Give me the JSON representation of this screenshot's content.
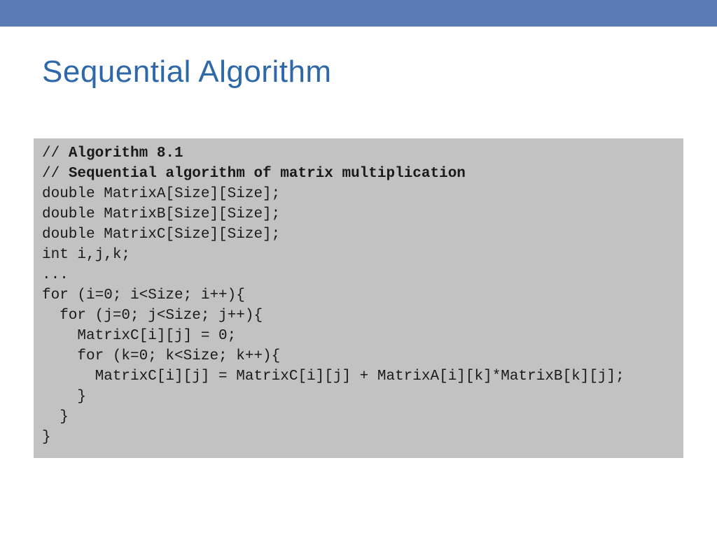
{
  "title": "Sequential Algorithm",
  "code": {
    "comment1": "// ",
    "comment1_bold": "Algorithm 8.1",
    "comment2": "// ",
    "comment2_bold": "Sequential algorithm of matrix multiplication",
    "line3": "double MatrixA[Size][Size];",
    "line4": "double MatrixB[Size][Size];",
    "line5": "double MatrixC[Size][Size];",
    "line6": "int i,j,k;",
    "line7": "...",
    "line8": "for (i=0; i<Size; i++){",
    "line9": "  for (j=0; j<Size; j++){",
    "line10": "    MatrixC[i][j] = 0;",
    "line11": "    for (k=0; k<Size; k++){",
    "line12": "      MatrixC[i][j] = MatrixC[i][j] + MatrixA[i][k]*MatrixB[k][j];",
    "line13": "    }",
    "line14": "  }",
    "line15": "}"
  }
}
